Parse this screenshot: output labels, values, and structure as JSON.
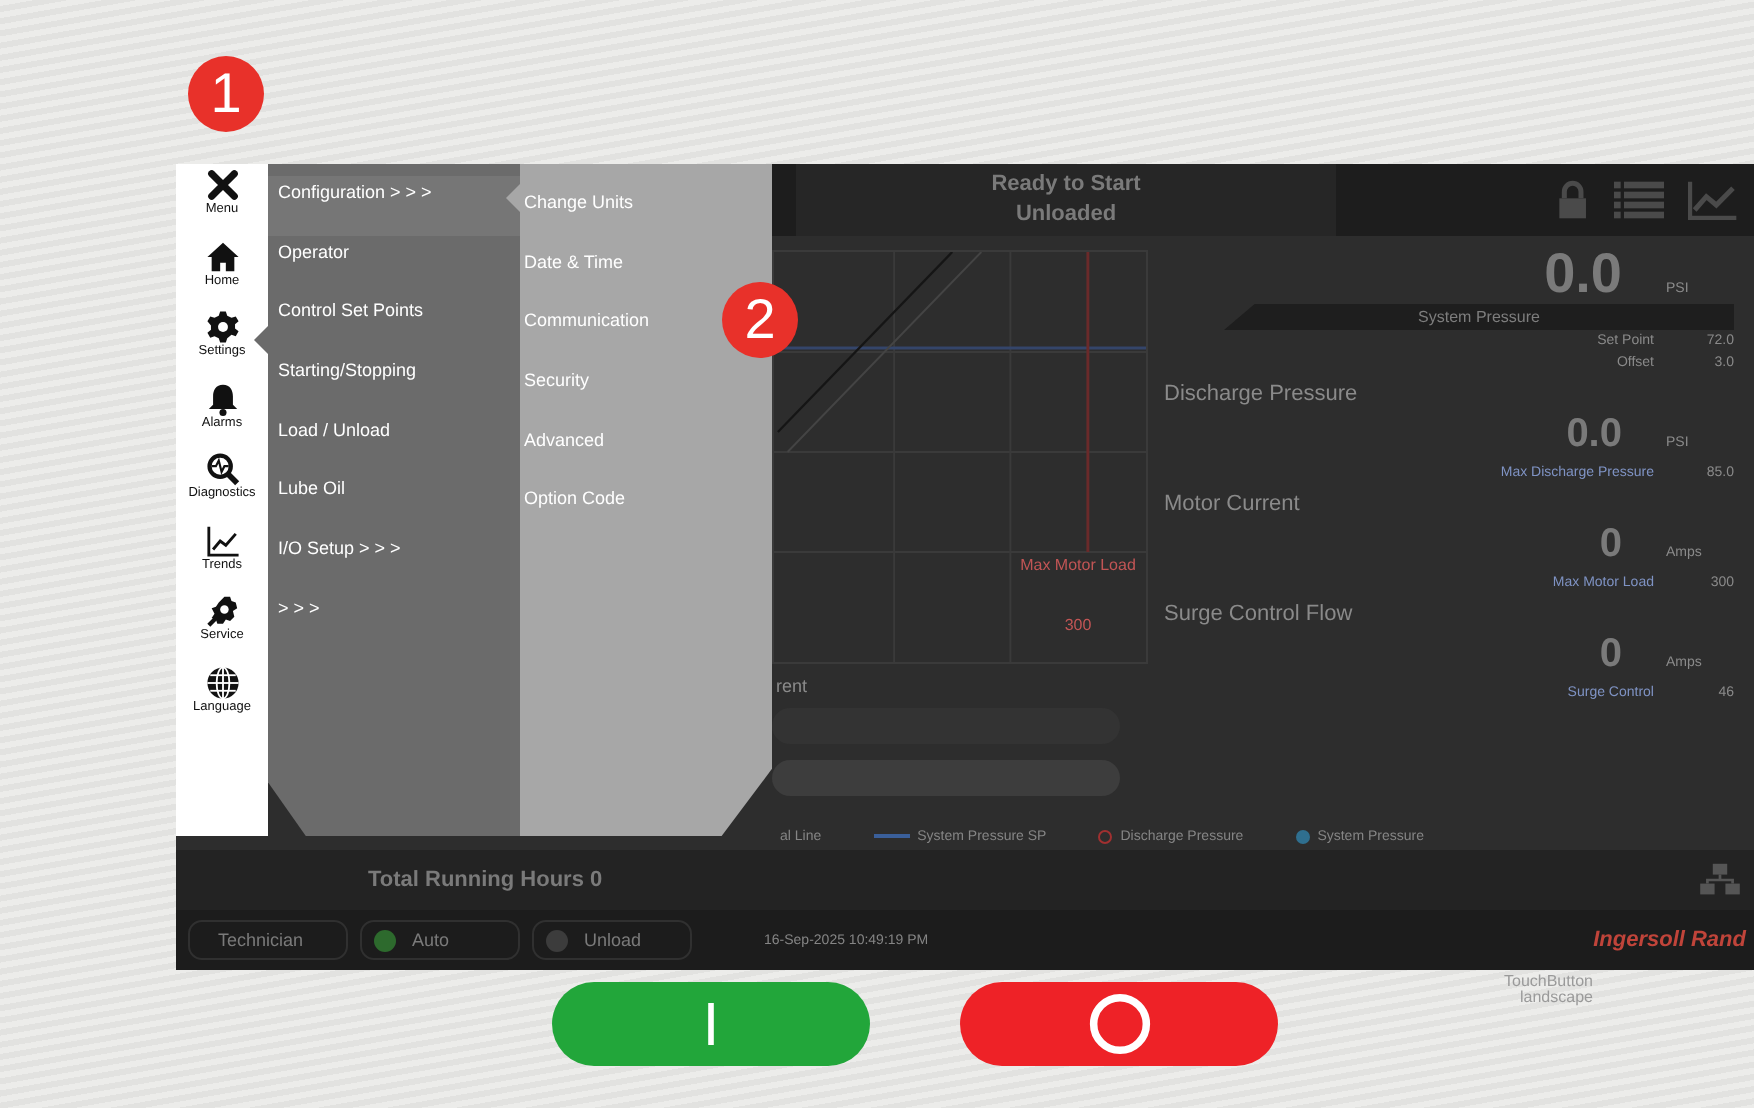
{
  "badges": [
    "1",
    "2"
  ],
  "sidebar": [
    {
      "label": "Menu",
      "kind": "close",
      "selected": false
    },
    {
      "label": "Home",
      "kind": "home",
      "selected": false
    },
    {
      "label": "Settings",
      "kind": "gear",
      "selected": true
    },
    {
      "label": "Alarms",
      "kind": "bell",
      "selected": false
    },
    {
      "label": "Diagnostics",
      "kind": "diagnostics",
      "selected": false
    },
    {
      "label": "Trends",
      "kind": "trends",
      "selected": false
    },
    {
      "label": "Service",
      "kind": "service",
      "selected": false
    },
    {
      "label": "Language",
      "kind": "globe",
      "selected": false
    }
  ],
  "menu": [
    {
      "label": "Configuration > > >",
      "selected": true
    },
    {
      "label": "Operator",
      "selected": false
    },
    {
      "label": "Control Set Points",
      "selected": false
    },
    {
      "label": "Starting/Stopping",
      "selected": false
    },
    {
      "label": "Load / Unload",
      "selected": false
    },
    {
      "label": "Lube Oil",
      "selected": false
    },
    {
      "label": "I/O Setup > > >",
      "selected": false
    },
    {
      "label": "> > >",
      "selected": false
    }
  ],
  "submenu": [
    "Change Units",
    "Date & Time",
    "Communication",
    "Security",
    "Advanced",
    "Option Code"
  ],
  "header": {
    "status": "Ready to Start",
    "substatus": "Unloaded"
  },
  "trend": {
    "marker_label": "Max Motor Load",
    "marker_value": "300"
  },
  "current_fragment": "rent",
  "system_pressure": {
    "value": "0.0",
    "unit": "PSI",
    "label": "System Pressure",
    "settings": [
      {
        "label": "Set Point",
        "value": "72.0"
      },
      {
        "label": "Offset",
        "value": "3.0"
      }
    ]
  },
  "readouts": [
    {
      "title": "Discharge Pressure",
      "value": "0.0",
      "unit": "PSI",
      "limit_label": "Max Discharge Pressure",
      "limit_value": "85.0"
    },
    {
      "title": "Motor Current",
      "value": "0",
      "unit": "Amps",
      "limit_label": "Max Motor Load",
      "limit_value": "300"
    },
    {
      "title": "Surge Control Flow",
      "value": "0",
      "unit": "Amps",
      "limit_label": "Surge Control",
      "limit_value": "46"
    }
  ],
  "legend": [
    {
      "label": "al Line",
      "kind": "text"
    },
    {
      "label": "System Pressure SP",
      "kind": "line",
      "color": "#3a5f9a"
    },
    {
      "label": "Discharge Pressure",
      "kind": "ring",
      "color": "#a03030"
    },
    {
      "label": "System Pressure",
      "kind": "dot",
      "color": "#2f6f8f"
    }
  ],
  "total_running_hours": "Total Running Hours 0",
  "status_bar": {
    "user": "Technician",
    "indicators": [
      {
        "label": "Auto",
        "on": true
      },
      {
        "label": "Unload",
        "on": false
      }
    ],
    "datetime": "16-Sep-2025 10:49:19 PM",
    "brand": "Ingersoll Rand"
  },
  "panel_label": [
    "TouchButton",
    "landscape"
  ]
}
